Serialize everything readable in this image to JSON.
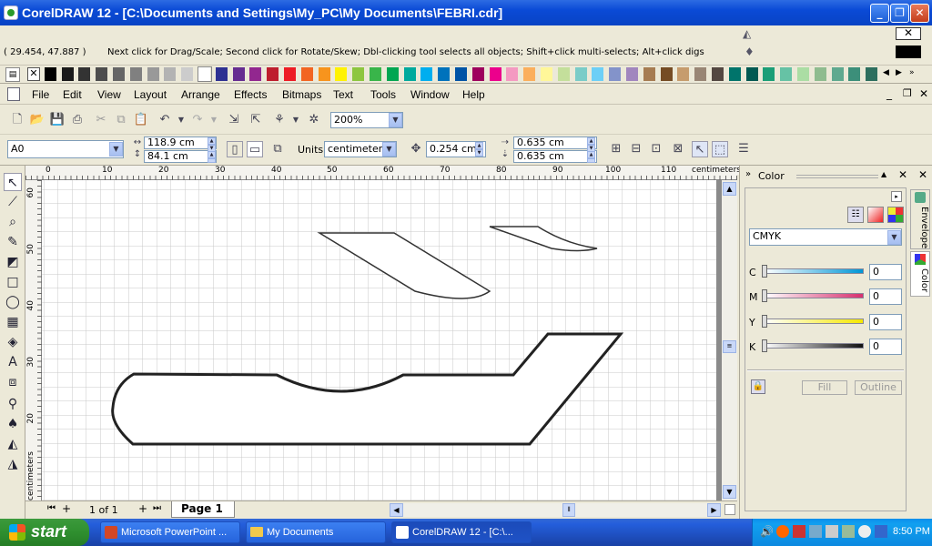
{
  "window": {
    "title": "CorelDRAW 12 - [C:\\Documents and Settings\\My_PC\\My Documents\\FEBRI.cdr]"
  },
  "status": {
    "coords": "( 29.454, 47.887 )",
    "hint": "Next click for Drag/Scale; Second click for Rotate/Skew; Dbl-clicking tool selects all objects; Shift+click multi-selects; Alt+click digs"
  },
  "palette_colors": [
    "#ffffff",
    "#000000",
    "#1a1a1a",
    "#333333",
    "#4d4d4d",
    "#666666",
    "#808080",
    "#999999",
    "#b3b3b3",
    "#cccccc",
    "#ffffff",
    "#2e3192",
    "#662d91",
    "#92278f",
    "#be1e2d",
    "#ed1c24",
    "#f26522",
    "#f7941d",
    "#fff200",
    "#8dc63f",
    "#39b54a",
    "#00a651",
    "#00a99d",
    "#00aeef",
    "#0072bc",
    "#0054a6",
    "#9e005d",
    "#ec008c",
    "#f49ac1",
    "#fbaf5d",
    "#fff799",
    "#c4df9b",
    "#7accc8",
    "#6dcff6",
    "#8393ca",
    "#a186be",
    "#a67c52",
    "#754c24",
    "#c69c6d",
    "#998675",
    "#534741",
    "#00746b",
    "#005952",
    "#1b9e77",
    "#66c2a5",
    "#abdda4",
    "#8fbc8f",
    "#5fa98f",
    "#3c8f7a",
    "#2d6e5e"
  ],
  "menu": [
    "File",
    "Edit",
    "View",
    "Layout",
    "Arrange",
    "Effects",
    "Bitmaps",
    "Text",
    "Tools",
    "Window",
    "Help"
  ],
  "toolbar": {
    "zoom": "200%"
  },
  "property_bar": {
    "paper": "A0",
    "width": "118.9 cm",
    "height": "84.1 cm",
    "units_label": "Units:",
    "units": "centimeters",
    "nudge": "0.254 cm",
    "dup_x": "0.635 cm",
    "dup_y": "0.635 cm"
  },
  "ruler": {
    "h_ticks": [
      "0",
      "10",
      "20",
      "30",
      "40",
      "50",
      "60",
      "70",
      "80",
      "90",
      "100",
      "110"
    ],
    "h_unit": "centimeters",
    "v_ticks": [
      "60",
      "50",
      "40",
      "30",
      "20"
    ],
    "v_unit": "centimeters"
  },
  "page_nav": {
    "count": "1 of 1",
    "tab": "Page 1"
  },
  "docker": {
    "title": "Color",
    "model": "CMYK",
    "channels": [
      {
        "label": "C",
        "value": "0",
        "gradient": "linear-gradient(90deg,#ffffff,#0096d6)"
      },
      {
        "label": "M",
        "value": "0",
        "gradient": "linear-gradient(90deg,#ffffff,#d6306e)"
      },
      {
        "label": "Y",
        "value": "0",
        "gradient": "linear-gradient(90deg,#ffffff,#f5e800)"
      },
      {
        "label": "K",
        "value": "0",
        "gradient": "linear-gradient(90deg,#ffffff,#111111)"
      }
    ],
    "fill_label": "Fill",
    "outline_label": "Outline",
    "tabs": [
      "Envelope",
      "Color"
    ]
  },
  "taskbar": {
    "start": "start",
    "tasks": [
      "Microsoft PowerPoint ...",
      "My Documents",
      "CorelDRAW 12 - [C:\\..."
    ],
    "clock": "8:50 PM"
  }
}
